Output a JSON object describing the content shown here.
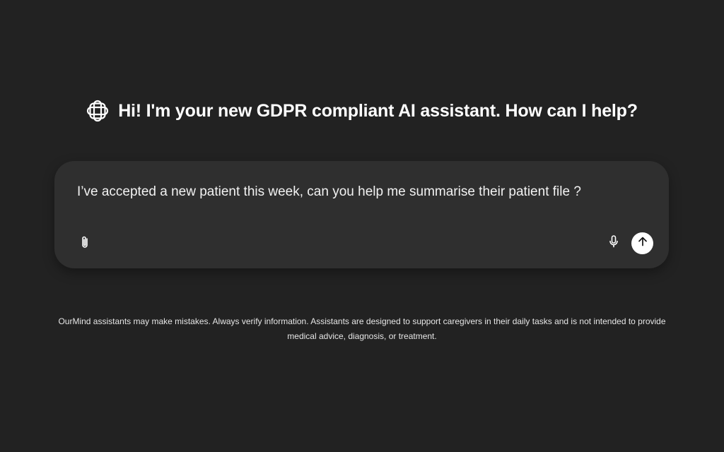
{
  "header": {
    "logo_icon": "asterisk-knot-logo-icon",
    "greeting": "Hi! I'm your new GDPR compliant AI assistant. How can I help?"
  },
  "composer": {
    "prompt_text": "I’ve accepted a new patient this week, can you help me summarise their patient file ?",
    "attach_icon": "paperclip-icon",
    "mic_icon": "microphone-icon",
    "send_icon": "arrow-up-icon"
  },
  "footer": {
    "disclaimer_line1": "OurMind assistants may make mistakes. Always verify information. Assistants are designed to support caregivers in their daily tasks and is not intended to provide",
    "disclaimer_line2": "medical advice, diagnosis, or treatment."
  },
  "colors": {
    "background": "#222222",
    "composer_bg": "#2f2f2f",
    "text": "#ffffff",
    "send_button_bg": "#ffffff"
  }
}
